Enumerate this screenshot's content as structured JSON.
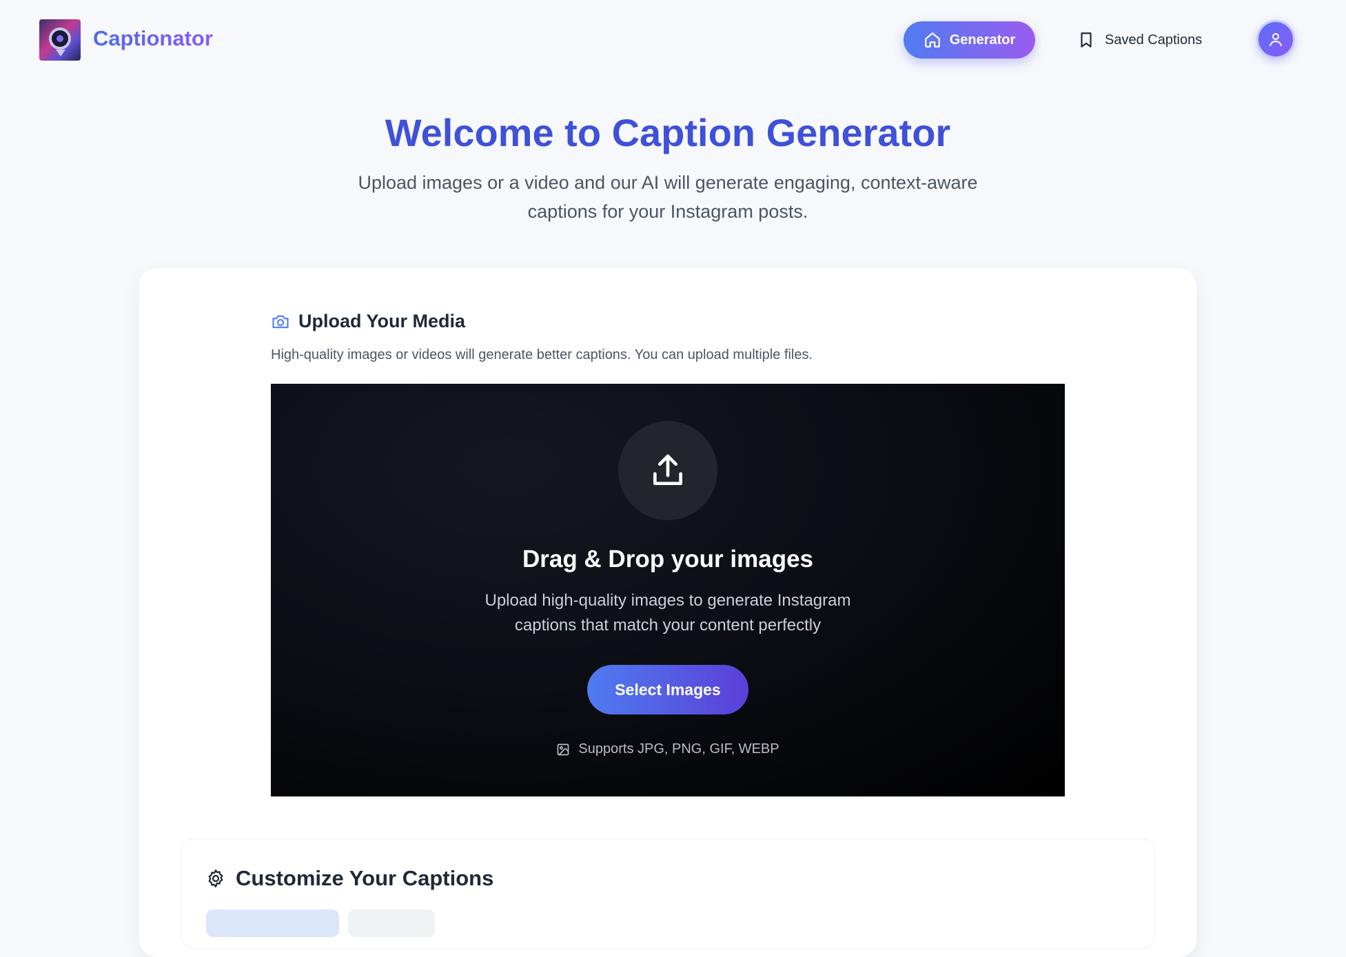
{
  "header": {
    "brand": "Captionator",
    "nav": {
      "generator_label": "Generator",
      "saved_label": "Saved Captions"
    }
  },
  "hero": {
    "title": "Welcome to Caption Generator",
    "subtitle": "Upload images or a video and our AI will generate engaging, context-aware captions for your Instagram posts."
  },
  "upload": {
    "title": "Upload Your Media",
    "description": "High-quality images or videos will generate better captions. You can upload multiple files.",
    "dropzone": {
      "title": "Drag & Drop your images",
      "description": "Upload high-quality images to generate Instagram captions that match your content perfectly",
      "button_label": "Select Images",
      "supports": "Supports JPG, PNG, GIF, WEBP"
    }
  },
  "customize": {
    "title": "Customize Your Captions"
  },
  "colors": {
    "accent": "#3f51d8",
    "button_gradient_start": "#4f7cf0",
    "button_gradient_end": "#9b5cf0",
    "dropzone_bg": "#0a0c12"
  },
  "icons": {
    "logo": "camera-bubble-logo",
    "generator": "home-icon",
    "saved": "bookmark-icon",
    "avatar": "user-icon",
    "upload_section": "camera-icon",
    "upload": "upload-icon",
    "supports": "image-icon",
    "customize": "gear-icon"
  }
}
